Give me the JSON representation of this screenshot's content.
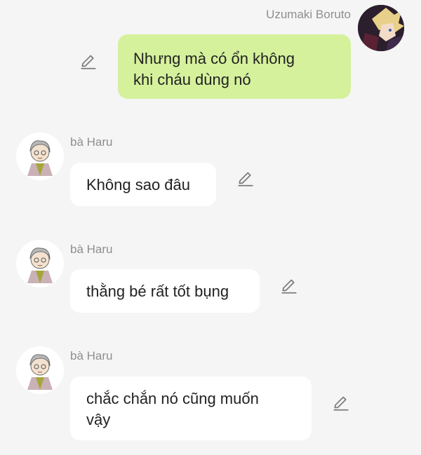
{
  "outgoing": {
    "sender_name": "Uzumaki Boruto",
    "text_line1": "Nhưng mà có ổn không",
    "text_line2": "khi cháu dùng nó"
  },
  "incoming": [
    {
      "sender_name": "bà Haru",
      "line1": "Không sao đâu",
      "line2": ""
    },
    {
      "sender_name": "bà Haru",
      "line1": "thằng bé rất tốt bụng",
      "line2": ""
    },
    {
      "sender_name": "bà Haru",
      "line1": "chắc chắn nó cũng muốn",
      "line2": "vậy"
    }
  ],
  "colors": {
    "background": "#f5f5f5",
    "outgoing_bubble": "#d5f19c",
    "incoming_bubble": "#ffffff",
    "name_text": "#8e8e8e",
    "icon": "#7a7a7a"
  },
  "icons": {
    "edit": "pencil-icon"
  }
}
